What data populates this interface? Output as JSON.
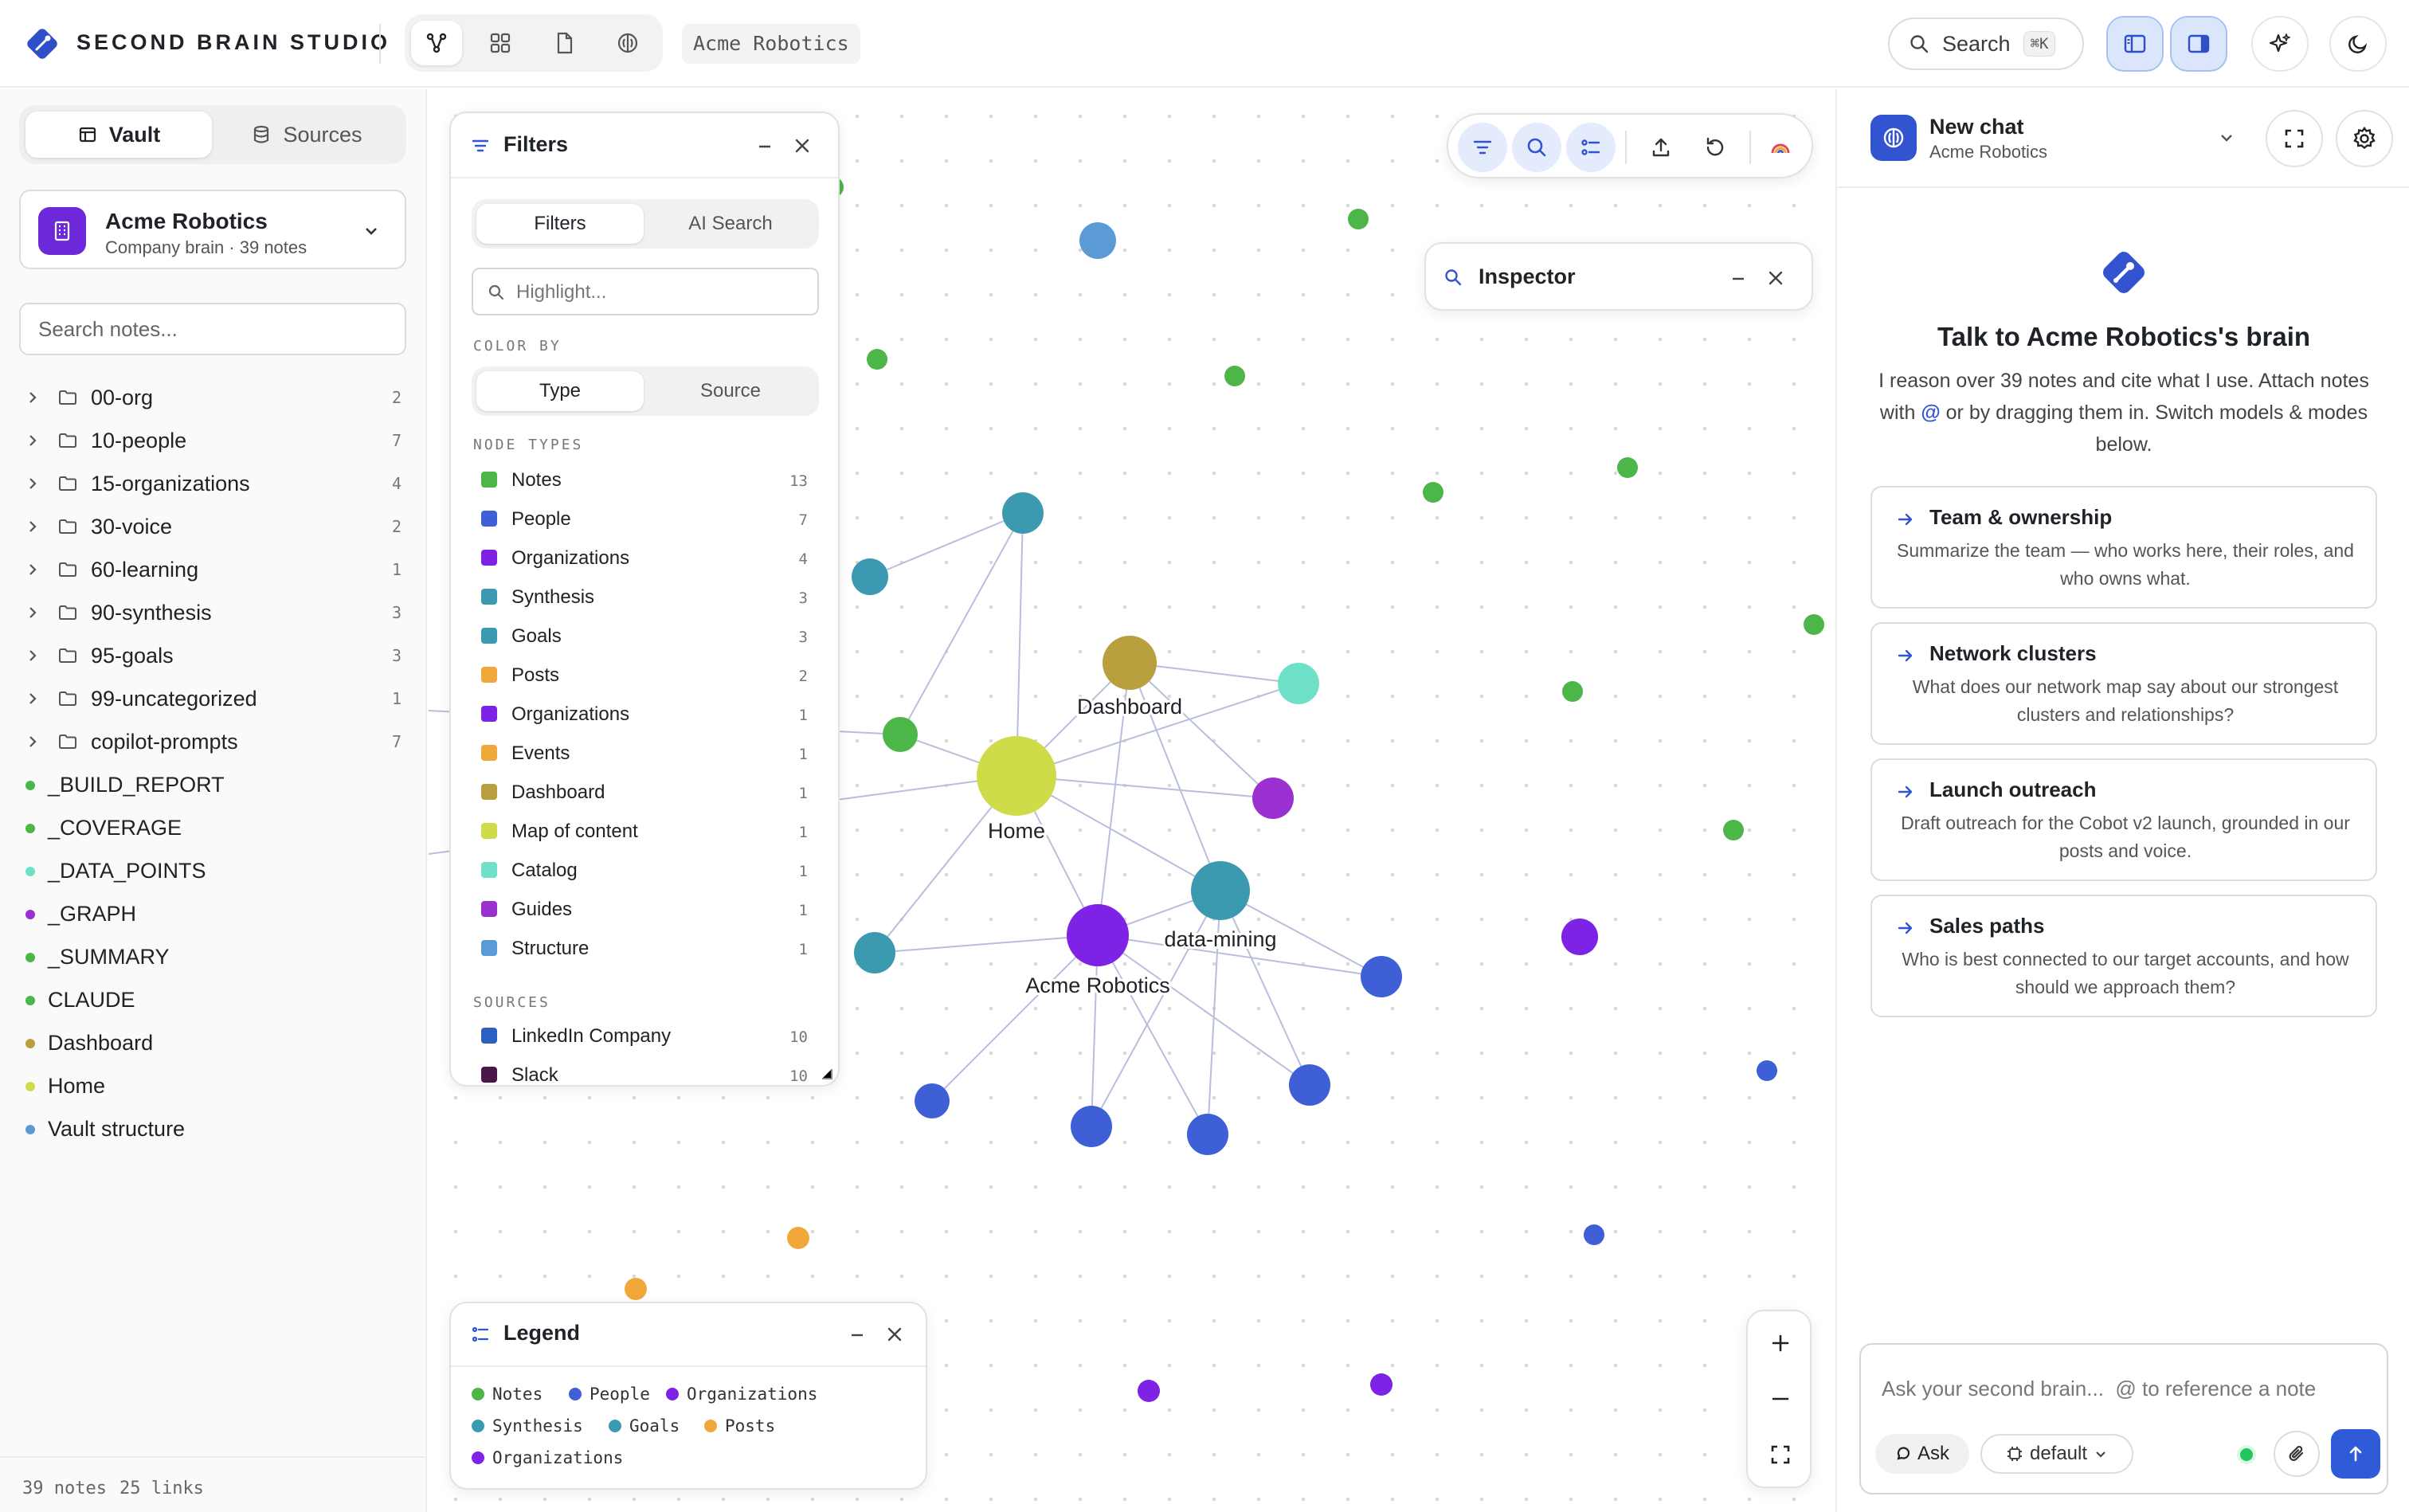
{
  "app": {
    "title": "SECOND BRAIN STUDIO",
    "vault_tag": "Acme Robotics"
  },
  "topbar": {
    "search_label": "Search",
    "search_shortcut": "⌘K"
  },
  "sidebar": {
    "tabs": [
      {
        "label": "Vault"
      },
      {
        "label": "Sources"
      }
    ],
    "workspace": {
      "name": "Acme Robotics",
      "sub": "Company brain · 39 notes"
    },
    "search_placeholder": "Search notes...",
    "folders": [
      {
        "name": "00-org",
        "count": "2"
      },
      {
        "name": "10-people",
        "count": "7"
      },
      {
        "name": "15-organizations",
        "count": "4"
      },
      {
        "name": "30-voice",
        "count": "2"
      },
      {
        "name": "60-learning",
        "count": "1"
      },
      {
        "name": "90-synthesis",
        "count": "3"
      },
      {
        "name": "95-goals",
        "count": "3"
      },
      {
        "name": "99-uncategorized",
        "count": "1"
      },
      {
        "name": "copilot-prompts",
        "count": "7"
      }
    ],
    "files": [
      {
        "name": "_BUILD_REPORT",
        "color": "#4cb648"
      },
      {
        "name": "_COVERAGE",
        "color": "#4cb648"
      },
      {
        "name": "_DATA_POINTS",
        "color": "#6ee0c8"
      },
      {
        "name": "_GRAPH",
        "color": "#9b30d0"
      },
      {
        "name": "_SUMMARY",
        "color": "#4cb648"
      },
      {
        "name": "CLAUDE",
        "color": "#4cb648"
      },
      {
        "name": "Dashboard",
        "color": "#b8a03e"
      },
      {
        "name": "Home",
        "color": "#cfdc4a"
      },
      {
        "name": "Vault structure",
        "color": "#5b9bd5"
      }
    ],
    "status_notes": "39 notes",
    "status_links": "25 links"
  },
  "filters": {
    "title": "Filters",
    "tabs": [
      "Filters",
      "AI Search"
    ],
    "highlight_placeholder": "Highlight...",
    "color_by_label": "COLOR BY",
    "color_by": [
      "Type",
      "Source"
    ],
    "node_types_label": "NODE TYPES",
    "node_types": [
      {
        "name": "Notes",
        "count": "13",
        "color": "#4cb648"
      },
      {
        "name": "People",
        "count": "7",
        "color": "#3e5fd6"
      },
      {
        "name": "Organizations",
        "count": "4",
        "color": "#7e22e6"
      },
      {
        "name": "Synthesis",
        "count": "3",
        "color": "#3b9ab0"
      },
      {
        "name": "Goals",
        "count": "3",
        "color": "#3a9bb0"
      },
      {
        "name": "Posts",
        "count": "2",
        "color": "#f0a83a"
      },
      {
        "name": "Organizations",
        "count": "1",
        "color": "#7e22e6"
      },
      {
        "name": "Events",
        "count": "1",
        "color": "#f0a83a"
      },
      {
        "name": "Dashboard",
        "count": "1",
        "color": "#b8a03e"
      },
      {
        "name": "Map of content",
        "count": "1",
        "color": "#cfdc4a"
      },
      {
        "name": "Catalog",
        "count": "1",
        "color": "#6ee0c8"
      },
      {
        "name": "Guides",
        "count": "1",
        "color": "#9b30d0"
      },
      {
        "name": "Structure",
        "count": "1",
        "color": "#5b9bd5"
      }
    ],
    "sources_label": "SOURCES",
    "sources": [
      {
        "name": "LinkedIn Company",
        "count": "10",
        "color": "#2c5fbf"
      },
      {
        "name": "Slack",
        "count": "10",
        "color": "#4a1848"
      }
    ]
  },
  "inspector": {
    "title": "Inspector"
  },
  "legend": {
    "title": "Legend",
    "items": [
      {
        "name": "Notes",
        "color": "#4cb648"
      },
      {
        "name": "People",
        "color": "#3e5fd6"
      },
      {
        "name": "Organizations",
        "color": "#7e22e6"
      },
      {
        "name": "Synthesis",
        "color": "#3b9ab0"
      },
      {
        "name": "Goals",
        "color": "#3a9bb0"
      },
      {
        "name": "Posts",
        "color": "#f0a83a"
      },
      {
        "name": "Organizations",
        "color": "#7e22e6"
      }
    ]
  },
  "graph": {
    "labels": {
      "home": "Home",
      "dashboard": "Dashboard",
      "data_mining": "data-mining",
      "acme": "Acme Robotics"
    }
  },
  "chat": {
    "title": "New chat",
    "sub": "Acme Robotics",
    "heading": "Talk to Acme Robotics's brain",
    "intro_before": "I reason over 39 notes and cite what I use. Attach notes with ",
    "intro_at": "@",
    "intro_after": " or by dragging them in. Switch models & modes below.",
    "suggestions": [
      {
        "title": "Team & ownership",
        "desc": "Summarize the team — who works here, their roles, and who owns what."
      },
      {
        "title": "Network clusters",
        "desc": "What does our network map say about our strongest clusters and relationships?"
      },
      {
        "title": "Launch outreach",
        "desc": "Draft outreach for the Cobot v2 launch, grounded in our posts and voice."
      },
      {
        "title": "Sales paths",
        "desc": "Who is best connected to our target accounts, and how should we approach them?"
      }
    ],
    "composer_placeholder": "Ask your second brain...  @ to reference a note",
    "mode_label": "Ask",
    "model_label": "default"
  },
  "colors": {
    "accent": "#2f5bd8",
    "brand_purple": "#6d28d9"
  }
}
